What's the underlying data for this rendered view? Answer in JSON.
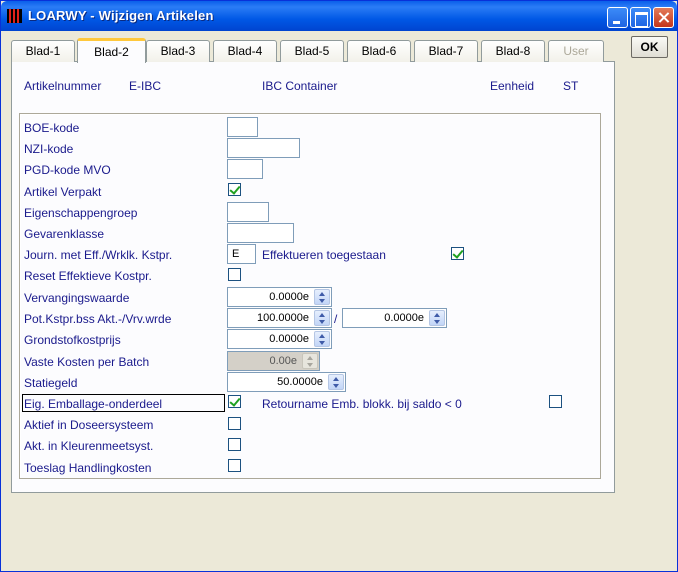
{
  "window": {
    "title": "LOARWY - Wijzigen Artikelen"
  },
  "tabs": [
    {
      "label": "Blad-1"
    },
    {
      "label": "Blad-2"
    },
    {
      "label": "Blad-3"
    },
    {
      "label": "Blad-4"
    },
    {
      "label": "Blad-5"
    },
    {
      "label": "Blad-6"
    },
    {
      "label": "Blad-7"
    },
    {
      "label": "Blad-8"
    },
    {
      "label": "User"
    }
  ],
  "active_tab": "Blad-2",
  "ok_label": "OK",
  "header": {
    "artikelnummer_label": "Artikelnummer",
    "artikelnummer_value": "E-IBC",
    "description": "IBC Container",
    "eenheid_label": "Eenheid",
    "eenheid_value": "ST"
  },
  "form": {
    "boe_kode": {
      "label": "BOE-kode",
      "value": ""
    },
    "nzi_kode": {
      "label": "NZI-kode",
      "value": ""
    },
    "pgd_kode": {
      "label": "PGD-kode MVO",
      "value": ""
    },
    "artikel_verpakt": {
      "label": "Artikel Verpakt",
      "checked": true
    },
    "eigenschappengroep": {
      "label": "Eigenschappengroep",
      "value": ""
    },
    "gevarenklasse": {
      "label": "Gevarenklasse",
      "value": ""
    },
    "journ": {
      "label": "Journ. met Eff./Wrklk. Kstpr.",
      "value": "E"
    },
    "effektueren": {
      "label": "Effektueren toegestaan",
      "checked": true
    },
    "reset": {
      "label": "Reset Effektieve Kostpr.",
      "checked": false
    },
    "vervangingswaarde": {
      "label": "Vervangingswaarde",
      "value": "0.0000e"
    },
    "pot_kstpr": {
      "label": "Pot.Kstpr.bss Akt.-/Vrv.wrde",
      "value1": "100.0000e",
      "separator": "/",
      "value2": "0.0000e"
    },
    "grondstofkostprijs": {
      "label": "Grondstofkostprijs",
      "value": "0.0000e"
    },
    "vaste_kosten": {
      "label": "Vaste Kosten per Batch",
      "value": "0.00e"
    },
    "statiegeld": {
      "label": "Statiegeld",
      "value": "50.0000e"
    },
    "eig_emballage": {
      "label": "Eig. Emballage-onderdeel",
      "checked": true
    },
    "retourname": {
      "label": "Retourname Emb. blokk. bij saldo < 0",
      "checked": false
    },
    "aktief_dosing": {
      "label": "Aktief in Doseersysteem",
      "checked": false
    },
    "akt_kleuren": {
      "label": "Akt. in Kleurenmeetsyst.",
      "checked": false
    },
    "toeslag": {
      "label": "Toeslag Handlingkosten",
      "checked": false
    }
  },
  "colors": {
    "label_text": "#1A1A8C",
    "titlebar": "#0058E6",
    "window_bg": "#ECE9D8",
    "active_tab_accent": "#FFC83C",
    "check": "#21A121"
  }
}
